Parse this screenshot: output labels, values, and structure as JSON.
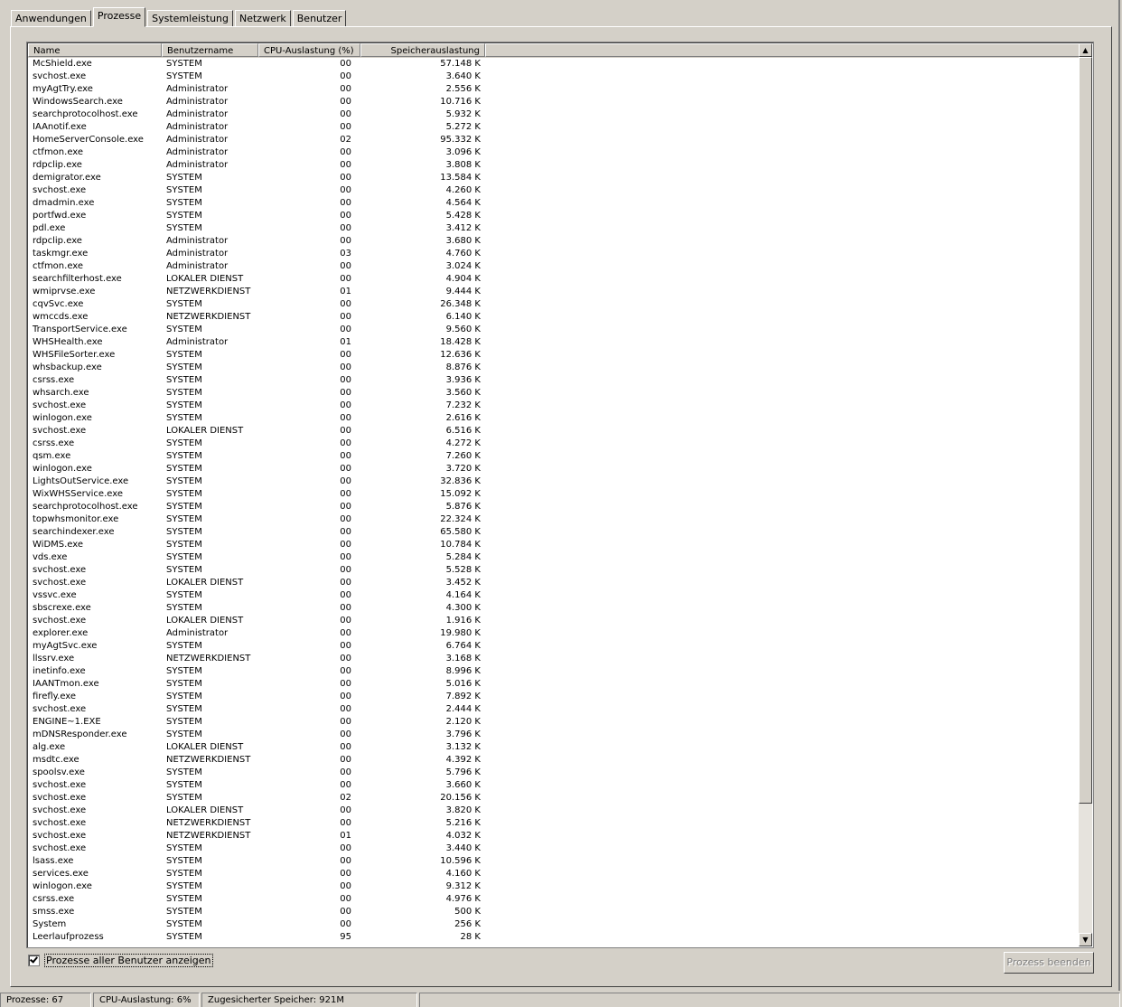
{
  "tabs": [
    "Anwendungen",
    "Prozesse",
    "Systemleistung",
    "Netzwerk",
    "Benutzer"
  ],
  "active_tab": "Prozesse",
  "columns": {
    "name": "Name",
    "user": "Benutzername",
    "cpu": "CPU-Auslastung (%)",
    "memory": "Speicherauslastung"
  },
  "processes": [
    [
      "McShield.exe",
      "SYSTEM",
      "00",
      "57.148 K"
    ],
    [
      "svchost.exe",
      "SYSTEM",
      "00",
      "3.640 K"
    ],
    [
      "myAgtTry.exe",
      "Administrator",
      "00",
      "2.556 K"
    ],
    [
      "WindowsSearch.exe",
      "Administrator",
      "00",
      "10.716 K"
    ],
    [
      "searchprotocolhost.exe",
      "Administrator",
      "00",
      "5.932 K"
    ],
    [
      "IAAnotif.exe",
      "Administrator",
      "00",
      "5.272 K"
    ],
    [
      "HomeServerConsole.exe",
      "Administrator",
      "02",
      "95.332 K"
    ],
    [
      "ctfmon.exe",
      "Administrator",
      "00",
      "3.096 K"
    ],
    [
      "rdpclip.exe",
      "Administrator",
      "00",
      "3.808 K"
    ],
    [
      "demigrator.exe",
      "SYSTEM",
      "00",
      "13.584 K"
    ],
    [
      "svchost.exe",
      "SYSTEM",
      "00",
      "4.260 K"
    ],
    [
      "dmadmin.exe",
      "SYSTEM",
      "00",
      "4.564 K"
    ],
    [
      "portfwd.exe",
      "SYSTEM",
      "00",
      "5.428 K"
    ],
    [
      "pdl.exe",
      "SYSTEM",
      "00",
      "3.412 K"
    ],
    [
      "rdpclip.exe",
      "Administrator",
      "00",
      "3.680 K"
    ],
    [
      "taskmgr.exe",
      "Administrator",
      "03",
      "4.760 K"
    ],
    [
      "ctfmon.exe",
      "Administrator",
      "00",
      "3.024 K"
    ],
    [
      "searchfilterhost.exe",
      "LOKALER DIENST",
      "00",
      "4.904 K"
    ],
    [
      "wmiprvse.exe",
      "NETZWERKDIENST",
      "01",
      "9.444 K"
    ],
    [
      "cqvSvc.exe",
      "SYSTEM",
      "00",
      "26.348 K"
    ],
    [
      "wmccds.exe",
      "NETZWERKDIENST",
      "00",
      "6.140 K"
    ],
    [
      "TransportService.exe",
      "SYSTEM",
      "00",
      "9.560 K"
    ],
    [
      "WHSHealth.exe",
      "Administrator",
      "01",
      "18.428 K"
    ],
    [
      "WHSFileSorter.exe",
      "SYSTEM",
      "00",
      "12.636 K"
    ],
    [
      "whsbackup.exe",
      "SYSTEM",
      "00",
      "8.876 K"
    ],
    [
      "csrss.exe",
      "SYSTEM",
      "00",
      "3.936 K"
    ],
    [
      "whsarch.exe",
      "SYSTEM",
      "00",
      "3.560 K"
    ],
    [
      "svchost.exe",
      "SYSTEM",
      "00",
      "7.232 K"
    ],
    [
      "winlogon.exe",
      "SYSTEM",
      "00",
      "2.616 K"
    ],
    [
      "svchost.exe",
      "LOKALER DIENST",
      "00",
      "6.516 K"
    ],
    [
      "csrss.exe",
      "SYSTEM",
      "00",
      "4.272 K"
    ],
    [
      "qsm.exe",
      "SYSTEM",
      "00",
      "7.260 K"
    ],
    [
      "winlogon.exe",
      "SYSTEM",
      "00",
      "3.720 K"
    ],
    [
      "LightsOutService.exe",
      "SYSTEM",
      "00",
      "32.836 K"
    ],
    [
      "WixWHSService.exe",
      "SYSTEM",
      "00",
      "15.092 K"
    ],
    [
      "searchprotocolhost.exe",
      "SYSTEM",
      "00",
      "5.876 K"
    ],
    [
      "topwhsmonitor.exe",
      "SYSTEM",
      "00",
      "22.324 K"
    ],
    [
      "searchindexer.exe",
      "SYSTEM",
      "00",
      "65.580 K"
    ],
    [
      "WiDMS.exe",
      "SYSTEM",
      "00",
      "10.784 K"
    ],
    [
      "vds.exe",
      "SYSTEM",
      "00",
      "5.284 K"
    ],
    [
      "svchost.exe",
      "SYSTEM",
      "00",
      "5.528 K"
    ],
    [
      "svchost.exe",
      "LOKALER DIENST",
      "00",
      "3.452 K"
    ],
    [
      "vssvc.exe",
      "SYSTEM",
      "00",
      "4.164 K"
    ],
    [
      "sbscrexe.exe",
      "SYSTEM",
      "00",
      "4.300 K"
    ],
    [
      "svchost.exe",
      "LOKALER DIENST",
      "00",
      "1.916 K"
    ],
    [
      "explorer.exe",
      "Administrator",
      "00",
      "19.980 K"
    ],
    [
      "myAgtSvc.exe",
      "SYSTEM",
      "00",
      "6.764 K"
    ],
    [
      "llssrv.exe",
      "NETZWERKDIENST",
      "00",
      "3.168 K"
    ],
    [
      "inetinfo.exe",
      "SYSTEM",
      "00",
      "8.996 K"
    ],
    [
      "IAANTmon.exe",
      "SYSTEM",
      "00",
      "5.016 K"
    ],
    [
      "firefly.exe",
      "SYSTEM",
      "00",
      "7.892 K"
    ],
    [
      "svchost.exe",
      "SYSTEM",
      "00",
      "2.444 K"
    ],
    [
      "ENGINE~1.EXE",
      "SYSTEM",
      "00",
      "2.120 K"
    ],
    [
      "mDNSResponder.exe",
      "SYSTEM",
      "00",
      "3.796 K"
    ],
    [
      "alg.exe",
      "LOKALER DIENST",
      "00",
      "3.132 K"
    ],
    [
      "msdtc.exe",
      "NETZWERKDIENST",
      "00",
      "4.392 K"
    ],
    [
      "spoolsv.exe",
      "SYSTEM",
      "00",
      "5.796 K"
    ],
    [
      "svchost.exe",
      "SYSTEM",
      "00",
      "3.660 K"
    ],
    [
      "svchost.exe",
      "SYSTEM",
      "02",
      "20.156 K"
    ],
    [
      "svchost.exe",
      "LOKALER DIENST",
      "00",
      "3.820 K"
    ],
    [
      "svchost.exe",
      "NETZWERKDIENST",
      "00",
      "5.216 K"
    ],
    [
      "svchost.exe",
      "NETZWERKDIENST",
      "01",
      "4.032 K"
    ],
    [
      "svchost.exe",
      "SYSTEM",
      "00",
      "3.440 K"
    ],
    [
      "lsass.exe",
      "SYSTEM",
      "00",
      "10.596 K"
    ],
    [
      "services.exe",
      "SYSTEM",
      "00",
      "4.160 K"
    ],
    [
      "winlogon.exe",
      "SYSTEM",
      "00",
      "9.312 K"
    ],
    [
      "csrss.exe",
      "SYSTEM",
      "00",
      "4.976 K"
    ],
    [
      "smss.exe",
      "SYSTEM",
      "00",
      "500 K"
    ],
    [
      "System",
      "SYSTEM",
      "00",
      "256 K"
    ],
    [
      "Leerlaufprozess",
      "SYSTEM",
      "95",
      "28 K"
    ]
  ],
  "show_all_users": {
    "label": "Prozesse aller Benutzer anzeigen",
    "checked": true
  },
  "end_process_button": "Prozess beenden",
  "status": {
    "processes": "Prozesse: 67",
    "cpu": "CPU-Auslastung: 6%",
    "commit": "Zugesicherter Speicher: 921M"
  },
  "icons": {
    "scroll_up": "scroll-up-arrow-icon",
    "scroll_down": "scroll-down-arrow-icon",
    "check": "checkmark-icon"
  }
}
